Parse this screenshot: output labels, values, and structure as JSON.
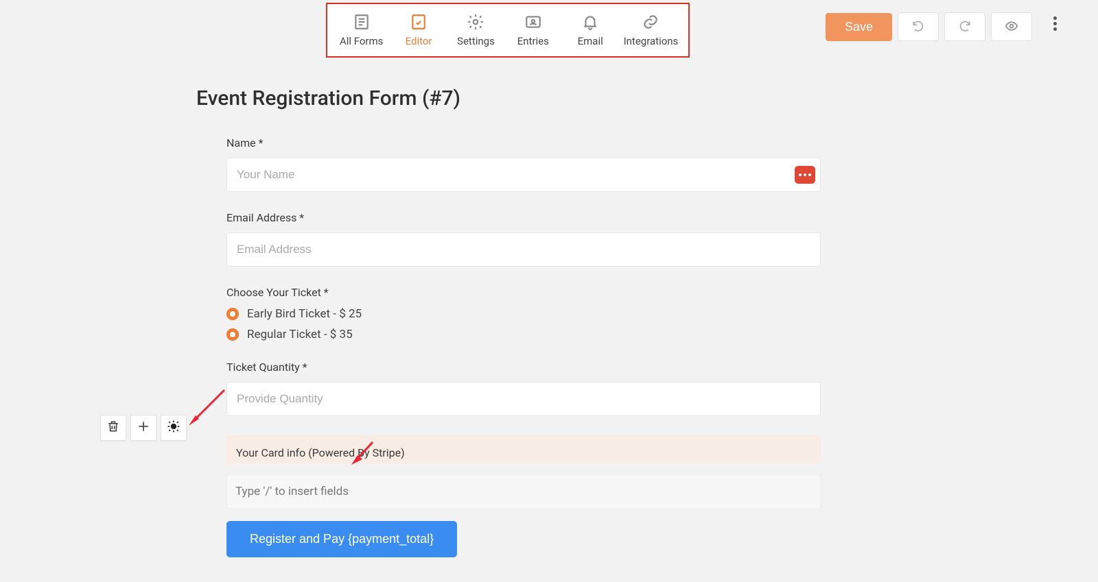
{
  "nav": {
    "items": [
      {
        "label": "All Forms"
      },
      {
        "label": "Editor"
      },
      {
        "label": "Settings"
      },
      {
        "label": "Entries"
      },
      {
        "label": "Email"
      },
      {
        "label": "Integrations"
      }
    ]
  },
  "actions": {
    "save_label": "Save"
  },
  "page": {
    "title": "Event Registration Form (#7)"
  },
  "fields": {
    "name": {
      "label": "Name *",
      "placeholder": "Your Name"
    },
    "email": {
      "label": "Email Address *",
      "placeholder": "Email Address"
    },
    "ticket_choice": {
      "label": "Choose Your Ticket *",
      "options": [
        "Early Bird Ticket - $ 25",
        "Regular Ticket - $ 35"
      ]
    },
    "quantity": {
      "label": "Ticket Quantity *",
      "placeholder": "Provide Quantity"
    },
    "card": {
      "label": "Your Card info (Powered By Stripe)"
    },
    "insert_hint": "Type '/' to insert fields",
    "submit_label": "Register and Pay {payment_total}"
  }
}
